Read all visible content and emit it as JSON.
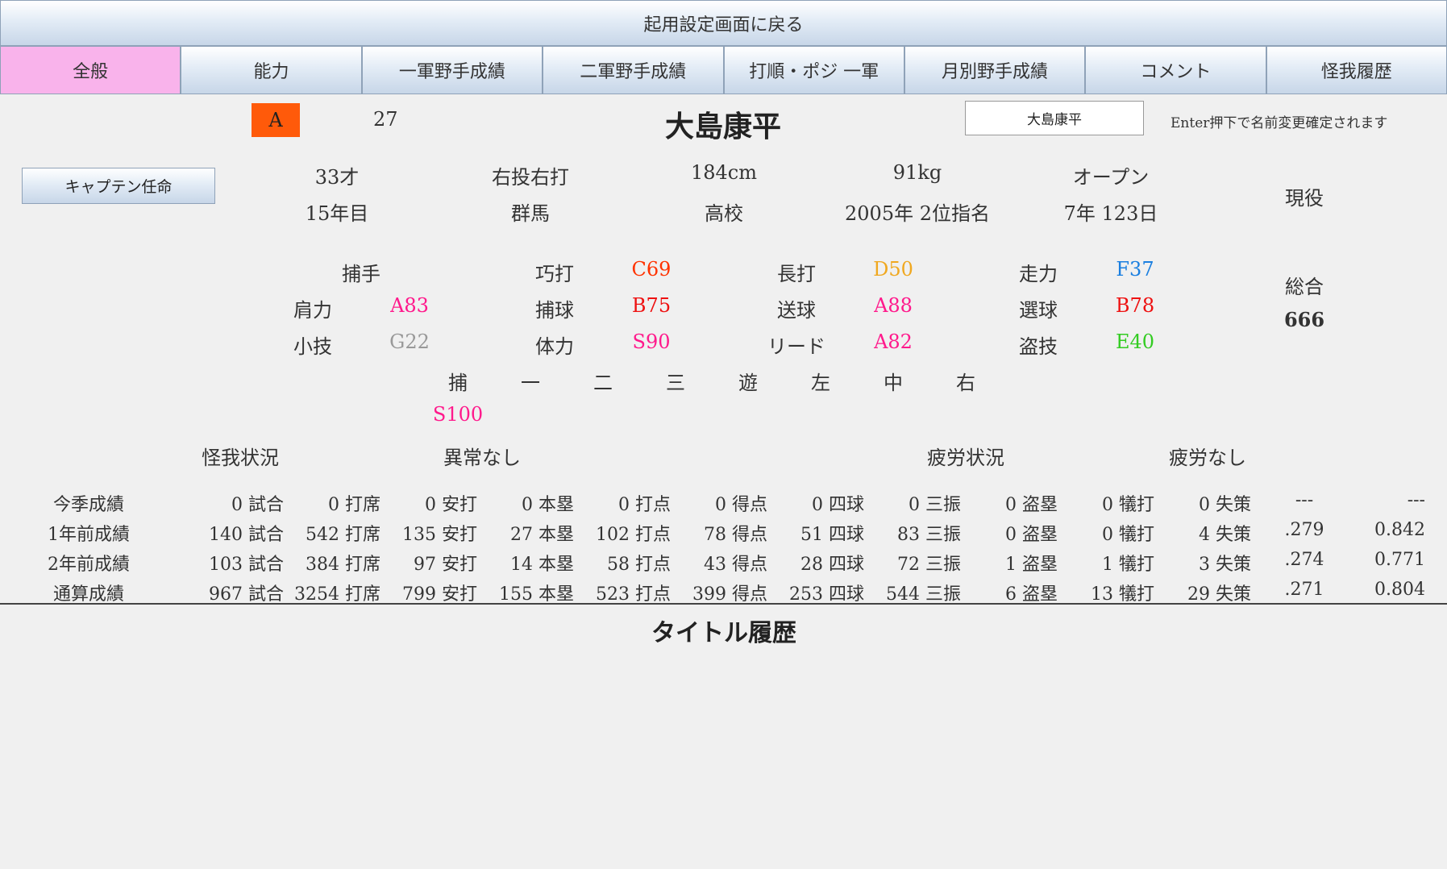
{
  "back_label": "起用設定画面に戻る",
  "tabs": [
    "全般",
    "能力",
    "一軍野手成績",
    "二軍野手成績",
    "打順・ポジ 一軍",
    "月別野手成績",
    "コメント",
    "怪我履歴"
  ],
  "player": {
    "rank": "A",
    "number": "27",
    "name": "大島康平",
    "name_input_value": "大島康平",
    "name_hint": "Enter押下で名前変更確定されます",
    "age": "33才",
    "throw_bat": "右投右打",
    "height": "184cm",
    "weight": "91kg",
    "batting_form": "オープン",
    "years": "15年目",
    "hometown": "群馬",
    "school": "高校",
    "draft": "2005年 2位指名",
    "service": "7年 123日",
    "status": "現役",
    "captain_button": "キャプテン任命"
  },
  "abilities": {
    "position": "捕手",
    "rows": [
      [
        {
          "label": "巧打",
          "value": "C69",
          "color": "#ff3300"
        },
        {
          "label": "長打",
          "value": "D50",
          "color": "#f0a820"
        },
        {
          "label": "走力",
          "value": "F37",
          "color": "#1a7fe0"
        }
      ],
      [
        {
          "label": "肩力",
          "value": "A83",
          "color": "#ff1a8c"
        },
        {
          "label": "捕球",
          "value": "B75",
          "color": "#ee1111"
        },
        {
          "label": "送球",
          "value": "A88",
          "color": "#ff1a8c"
        },
        {
          "label": "選球",
          "value": "B78",
          "color": "#ee1111"
        }
      ],
      [
        {
          "label": "小技",
          "value": "G22",
          "color": "#999999"
        },
        {
          "label": "体力",
          "value": "S90",
          "color": "#ff1a8c"
        },
        {
          "label": "リード",
          "value": "A82",
          "color": "#ff1a8c"
        },
        {
          "label": "盗技",
          "value": "E40",
          "color": "#33cc22"
        }
      ]
    ],
    "overall_label": "総合",
    "overall_value": "666",
    "positions": [
      "捕",
      "一",
      "二",
      "三",
      "遊",
      "左",
      "中",
      "右"
    ],
    "position_rating": {
      "value": "S100",
      "color": "#ff1a8c"
    }
  },
  "condition": {
    "injury_label": "怪我状況",
    "injury_value": "異常なし",
    "fatigue_label": "疲労状況",
    "fatigue_value": "疲労なし"
  },
  "stats": {
    "rows": [
      {
        "label": "今季成績",
        "cells": [
          "0 試合",
          "0 打席",
          "0 安打",
          "0 本塁",
          "0 打点",
          "0 得点",
          "0 四球",
          "0 三振",
          "0 盗塁",
          "0 犠打",
          "0 失策"
        ],
        "avg": "---",
        "ops": "---"
      },
      {
        "label": "1年前成績",
        "cells": [
          "140 試合",
          "542 打席",
          "135 安打",
          "27 本塁",
          "102 打点",
          "78 得点",
          "51 四球",
          "83 三振",
          "0 盗塁",
          "0 犠打",
          "4 失策"
        ],
        "avg": ".279",
        "ops": "0.842"
      },
      {
        "label": "2年前成績",
        "cells": [
          "103 試合",
          "384 打席",
          "97 安打",
          "14 本塁",
          "58 打点",
          "43 得点",
          "28 四球",
          "72 三振",
          "1 盗塁",
          "1 犠打",
          "3 失策"
        ],
        "avg": ".274",
        "ops": "0.771"
      },
      {
        "label": "通算成績",
        "cells": [
          "967 試合",
          "3254 打席",
          "799 安打",
          "155 本塁",
          "523 打点",
          "399 得点",
          "253 四球",
          "544 三振",
          "6 盗塁",
          "13 犠打",
          "29 失策"
        ],
        "avg": ".271",
        "ops": "0.804"
      }
    ]
  },
  "titles_heading": "タイトル履歴"
}
